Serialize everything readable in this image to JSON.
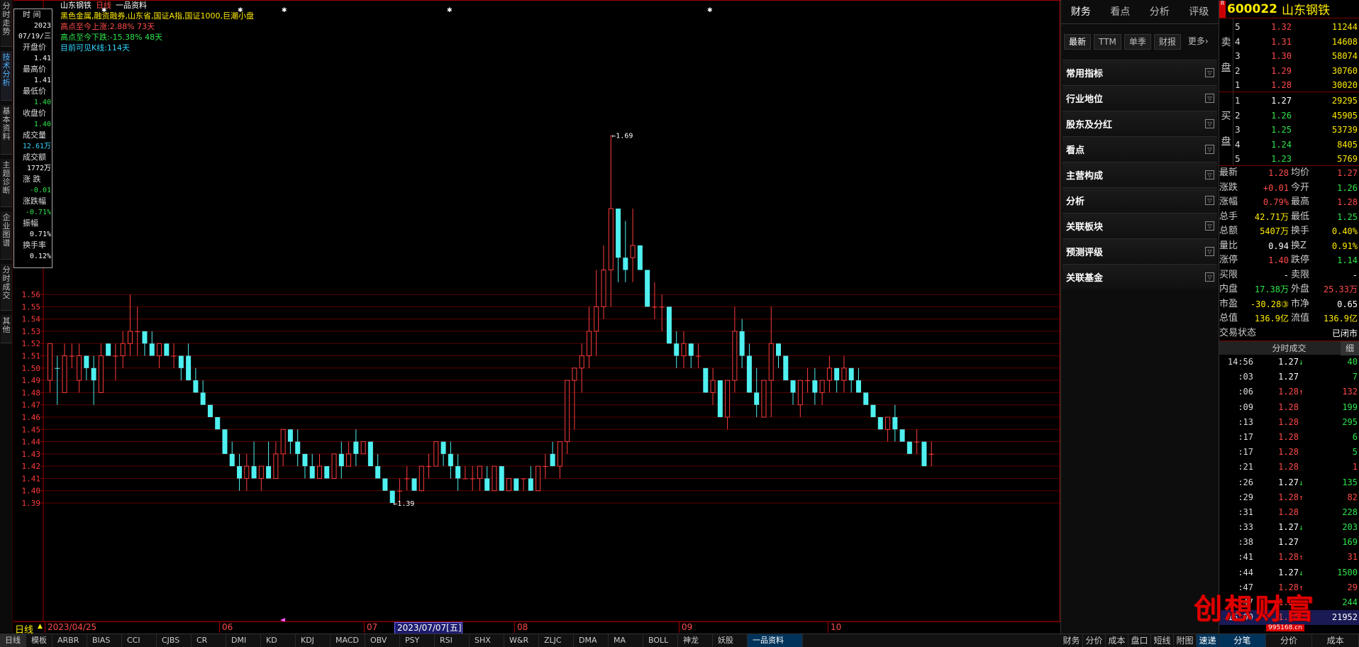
{
  "left_tabs": [
    "分时走势",
    "技术分析",
    "基本资料",
    "主题诊断",
    "企业图谱",
    "分时成交",
    "其他"
  ],
  "active_left_tab": 1,
  "chart_header": {
    "title_stock": "山东钢铁",
    "title_period": "日线",
    "title_source": "一品资料",
    "line2": "黑色金属,融资融券,山东省,国证A指,国证1000,巨潮小盘",
    "line3": "高点至今上涨:2.88% 73天",
    "line4": "高点至今下跌:-15.38% 48天",
    "line5": "目前可见K线:114天"
  },
  "data_window": {
    "rows": [
      {
        "label": "时 间",
        "value": "2023",
        "value2": "07/19/三",
        "color": "white"
      },
      {
        "label": "开盘价",
        "value": "1.41",
        "color": "white"
      },
      {
        "label": "最高价",
        "value": "1.41",
        "color": "white"
      },
      {
        "label": "最低价",
        "value": "1.40",
        "color": "green"
      },
      {
        "label": "收盘价",
        "value": "1.40",
        "color": "green"
      },
      {
        "label": "成交量",
        "value": "12.61万",
        "color": "cyan"
      },
      {
        "label": "成交额",
        "value": "1772万",
        "color": "white"
      },
      {
        "label": "涨 跌",
        "value": "-0.01",
        "color": "green"
      },
      {
        "label": "涨跌幅",
        "value": "-0.71%",
        "color": "green"
      },
      {
        "label": "振幅",
        "value": "0.71%",
        "color": "white"
      },
      {
        "label": "换手率",
        "value": "0.12%",
        "color": "white"
      }
    ]
  },
  "chart_data": {
    "type": "candlestick",
    "y_ticks": [
      "1.56",
      "1.55",
      "1.54",
      "1.53",
      "1.52",
      "1.51",
      "1.50",
      "1.49",
      "1.48",
      "1.47",
      "1.46",
      "1.45",
      "1.44",
      "1.43",
      "1.42",
      "1.41",
      "1.40",
      "1.39"
    ],
    "annotations": [
      {
        "label": "←1.69",
        "value": 1.69
      },
      {
        "label": "←1.39",
        "value": 1.39
      }
    ],
    "date_labels": [
      "2023/04/25",
      "06",
      "07",
      "2023/07/07[五]",
      "08",
      "09",
      "10"
    ],
    "period_label": "日线",
    "candles": [
      [
        1.49,
        1.52,
        1.48,
        1.52
      ],
      [
        1.5,
        1.51,
        1.47,
        1.5
      ],
      [
        1.48,
        1.52,
        1.48,
        1.51
      ],
      [
        1.51,
        1.52,
        1.5,
        1.51
      ],
      [
        1.49,
        1.52,
        1.48,
        1.51
      ],
      [
        1.51,
        1.51,
        1.49,
        1.5
      ],
      [
        1.5,
        1.51,
        1.47,
        1.49
      ],
      [
        1.48,
        1.52,
        1.48,
        1.51
      ],
      [
        1.52,
        1.52,
        1.51,
        1.51
      ],
      [
        1.51,
        1.52,
        1.49,
        1.51
      ],
      [
        1.51,
        1.53,
        1.5,
        1.52
      ],
      [
        1.52,
        1.56,
        1.51,
        1.53
      ],
      [
        1.53,
        1.55,
        1.51,
        1.53
      ],
      [
        1.53,
        1.53,
        1.51,
        1.52
      ],
      [
        1.52,
        1.53,
        1.51,
        1.51
      ],
      [
        1.51,
        1.52,
        1.5,
        1.52
      ],
      [
        1.52,
        1.52,
        1.51,
        1.51
      ],
      [
        1.51,
        1.52,
        1.5,
        1.51
      ],
      [
        1.51,
        1.51,
        1.49,
        1.5
      ],
      [
        1.51,
        1.52,
        1.49,
        1.49
      ],
      [
        1.49,
        1.5,
        1.48,
        1.48
      ],
      [
        1.48,
        1.49,
        1.47,
        1.47
      ],
      [
        1.47,
        1.47,
        1.46,
        1.46
      ],
      [
        1.46,
        1.46,
        1.45,
        1.45
      ],
      [
        1.45,
        1.45,
        1.43,
        1.43
      ],
      [
        1.43,
        1.44,
        1.42,
        1.42
      ],
      [
        1.42,
        1.43,
        1.4,
        1.41
      ],
      [
        1.41,
        1.43,
        1.4,
        1.42
      ],
      [
        1.42,
        1.44,
        1.41,
        1.41
      ],
      [
        1.41,
        1.42,
        1.4,
        1.42
      ],
      [
        1.42,
        1.44,
        1.41,
        1.41
      ],
      [
        1.41,
        1.44,
        1.41,
        1.43
      ],
      [
        1.43,
        1.45,
        1.42,
        1.45
      ],
      [
        1.45,
        1.45,
        1.43,
        1.44
      ],
      [
        1.44,
        1.45,
        1.42,
        1.43
      ],
      [
        1.43,
        1.43,
        1.41,
        1.42
      ],
      [
        1.42,
        1.43,
        1.41,
        1.41
      ],
      [
        1.41,
        1.43,
        1.41,
        1.42
      ],
      [
        1.42,
        1.42,
        1.41,
        1.41
      ],
      [
        1.41,
        1.43,
        1.41,
        1.43
      ],
      [
        1.43,
        1.44,
        1.41,
        1.42
      ],
      [
        1.42,
        1.44,
        1.42,
        1.43
      ],
      [
        1.44,
        1.45,
        1.42,
        1.43
      ],
      [
        1.43,
        1.44,
        1.43,
        1.44
      ],
      [
        1.44,
        1.44,
        1.42,
        1.42
      ],
      [
        1.42,
        1.43,
        1.41,
        1.41
      ],
      [
        1.41,
        1.41,
        1.4,
        1.4
      ],
      [
        1.4,
        1.4,
        1.39,
        1.39
      ],
      [
        1.4,
        1.41,
        1.39,
        1.4
      ],
      [
        1.41,
        1.42,
        1.4,
        1.41
      ],
      [
        1.41,
        1.41,
        1.4,
        1.4
      ],
      [
        1.4,
        1.42,
        1.4,
        1.42
      ],
      [
        1.42,
        1.43,
        1.41,
        1.42
      ],
      [
        1.42,
        1.44,
        1.42,
        1.44
      ],
      [
        1.44,
        1.44,
        1.42,
        1.43
      ],
      [
        1.43,
        1.44,
        1.41,
        1.42
      ],
      [
        1.42,
        1.43,
        1.4,
        1.41
      ],
      [
        1.41,
        1.42,
        1.41,
        1.41
      ],
      [
        1.41,
        1.42,
        1.4,
        1.41
      ],
      [
        1.41,
        1.42,
        1.4,
        1.42
      ],
      [
        1.41,
        1.42,
        1.4,
        1.4
      ],
      [
        1.4,
        1.42,
        1.4,
        1.42
      ],
      [
        1.42,
        1.42,
        1.4,
        1.4
      ],
      [
        1.4,
        1.41,
        1.4,
        1.41
      ],
      [
        1.41,
        1.41,
        1.4,
        1.4
      ],
      [
        1.41,
        1.41,
        1.4,
        1.41
      ],
      [
        1.41,
        1.42,
        1.4,
        1.4
      ],
      [
        1.4,
        1.42,
        1.4,
        1.42
      ],
      [
        1.42,
        1.43,
        1.41,
        1.42
      ],
      [
        1.43,
        1.44,
        1.42,
        1.42
      ],
      [
        1.42,
        1.44,
        1.41,
        1.44
      ],
      [
        1.44,
        1.49,
        1.43,
        1.49
      ],
      [
        1.49,
        1.5,
        1.45,
        1.5
      ],
      [
        1.5,
        1.52,
        1.48,
        1.51
      ],
      [
        1.51,
        1.55,
        1.5,
        1.53
      ],
      [
        1.53,
        1.58,
        1.51,
        1.55
      ],
      [
        1.55,
        1.6,
        1.54,
        1.58
      ],
      [
        1.58,
        1.69,
        1.55,
        1.63
      ],
      [
        1.63,
        1.63,
        1.57,
        1.59
      ],
      [
        1.59,
        1.62,
        1.57,
        1.58
      ],
      [
        1.59,
        1.63,
        1.57,
        1.6
      ],
      [
        1.6,
        1.6,
        1.58,
        1.58
      ],
      [
        1.58,
        1.58,
        1.55,
        1.55
      ],
      [
        1.55,
        1.57,
        1.54,
        1.55
      ],
      [
        1.55,
        1.56,
        1.53,
        1.55
      ],
      [
        1.55,
        1.55,
        1.52,
        1.52
      ],
      [
        1.52,
        1.53,
        1.5,
        1.51
      ],
      [
        1.51,
        1.53,
        1.5,
        1.52
      ],
      [
        1.52,
        1.52,
        1.5,
        1.51
      ],
      [
        1.51,
        1.52,
        1.5,
        1.51
      ],
      [
        1.5,
        1.5,
        1.48,
        1.48
      ],
      [
        1.48,
        1.5,
        1.47,
        1.49
      ],
      [
        1.49,
        1.49,
        1.46,
        1.46
      ],
      [
        1.46,
        1.49,
        1.45,
        1.49
      ],
      [
        1.49,
        1.55,
        1.48,
        1.53
      ],
      [
        1.53,
        1.54,
        1.5,
        1.51
      ],
      [
        1.51,
        1.52,
        1.48,
        1.48
      ],
      [
        1.48,
        1.5,
        1.46,
        1.47
      ],
      [
        1.46,
        1.49,
        1.46,
        1.49
      ],
      [
        1.49,
        1.55,
        1.46,
        1.52
      ],
      [
        1.52,
        1.52,
        1.5,
        1.51
      ],
      [
        1.51,
        1.51,
        1.49,
        1.49
      ],
      [
        1.49,
        1.49,
        1.47,
        1.48
      ],
      [
        1.47,
        1.49,
        1.46,
        1.49
      ],
      [
        1.49,
        1.5,
        1.48,
        1.49
      ],
      [
        1.49,
        1.5,
        1.47,
        1.48
      ],
      [
        1.48,
        1.49,
        1.47,
        1.49
      ],
      [
        1.49,
        1.51,
        1.48,
        1.5
      ],
      [
        1.5,
        1.5,
        1.48,
        1.49
      ],
      [
        1.49,
        1.51,
        1.48,
        1.5
      ],
      [
        1.5,
        1.5,
        1.48,
        1.49
      ],
      [
        1.49,
        1.5,
        1.48,
        1.48
      ],
      [
        1.48,
        1.48,
        1.47,
        1.47
      ],
      [
        1.47,
        1.47,
        1.46,
        1.46
      ],
      [
        1.46,
        1.46,
        1.45,
        1.45
      ],
      [
        1.45,
        1.46,
        1.44,
        1.46
      ],
      [
        1.46,
        1.47,
        1.44,
        1.45
      ],
      [
        1.45,
        1.45,
        1.44,
        1.44
      ],
      [
        1.44,
        1.44,
        1.43,
        1.43
      ],
      [
        1.44,
        1.45,
        1.43,
        1.44
      ],
      [
        1.44,
        1.44,
        1.42,
        1.42
      ],
      [
        1.43,
        1.44,
        1.42,
        1.43
      ]
    ]
  },
  "indicator_tabs": [
    "日线",
    "模板",
    "ARBR",
    "BIAS",
    "CCI",
    "CJBS",
    "CR",
    "DMI",
    "KD",
    "KDJ",
    "MACD",
    "OBV",
    "PSY",
    "RSI",
    "SHX",
    "W&R",
    "ZLJC",
    "DMA",
    "MA",
    "BOLL",
    "神龙",
    "妖股",
    "一品资料"
  ],
  "active_indicator": "一品资料",
  "mid_tabs": [
    "财务",
    "看点",
    "分析",
    "评级"
  ],
  "mid_subtabs": [
    "最新",
    "TTM",
    "单季",
    "财报",
    "更多›"
  ],
  "mid_sections": [
    "常用指标",
    "行业地位",
    "股东及分红",
    "看点",
    "主营构成",
    "分析",
    "关联板块",
    "预测评级",
    "关联基金"
  ],
  "mid_bottom": [
    "财务",
    "分价",
    "成本",
    "盘口",
    "短线",
    "附图",
    "速递"
  ],
  "quote_header": {
    "code": "600022",
    "name": "山东钢铁",
    "badge": "R"
  },
  "sell_label": [
    "卖",
    "盘"
  ],
  "buy_label": [
    "买",
    "盘"
  ],
  "sells": [
    {
      "lv": "5",
      "price": "1.32",
      "vol": "11244"
    },
    {
      "lv": "4",
      "price": "1.31",
      "vol": "14608"
    },
    {
      "lv": "3",
      "price": "1.30",
      "vol": "58074"
    },
    {
      "lv": "2",
      "price": "1.29",
      "vol": "30760"
    },
    {
      "lv": "1",
      "price": "1.28",
      "vol": "30020"
    }
  ],
  "buys": [
    {
      "lv": "1",
      "price": "1.27",
      "vol": "29295"
    },
    {
      "lv": "2",
      "price": "1.26",
      "vol": "45905"
    },
    {
      "lv": "3",
      "price": "1.25",
      "vol": "53739"
    },
    {
      "lv": "4",
      "price": "1.24",
      "vol": "8405"
    },
    {
      "lv": "5",
      "price": "1.23",
      "vol": "5769"
    }
  ],
  "quote_rows": [
    {
      "k": "最新",
      "v": "1.28",
      "vc": "red",
      "k2": "均价",
      "v2": "1.27",
      "v2c": "red"
    },
    {
      "k": "涨跌",
      "v": "+0.01",
      "vc": "red",
      "k2": "今开",
      "v2": "1.26",
      "v2c": "green"
    },
    {
      "k": "涨幅",
      "v": "0.79%",
      "vc": "red",
      "k2": "最高",
      "v2": "1.28",
      "v2c": "red"
    },
    {
      "k": "总手",
      "v": "42.71万",
      "vc": "yellow",
      "k2": "最低",
      "v2": "1.25",
      "v2c": "green"
    },
    {
      "k": "总额",
      "v": "5407万",
      "vc": "yellow",
      "k2": "换手",
      "v2": "0.40%",
      "v2c": "yellow"
    },
    {
      "k": "量比",
      "v": "0.94",
      "vc": "white",
      "k2": "换Z",
      "v2": "0.91%",
      "v2c": "yellow"
    },
    {
      "k": "涨停",
      "v": "1.40",
      "vc": "red",
      "k2": "跌停",
      "v2": "1.14",
      "v2c": "green"
    },
    {
      "k": "买限",
      "v": "-",
      "vc": "white",
      "k2": "卖限",
      "v2": "-",
      "v2c": "white"
    },
    {
      "k": "内盘",
      "v": "17.38万",
      "vc": "green",
      "k2": "外盘",
      "v2": "25.33万",
      "v2c": "red"
    },
    {
      "k": "市盈",
      "v": "-30.28③",
      "vc": "yellow",
      "k2": "市净",
      "v2": "0.65",
      "v2c": "white"
    },
    {
      "k": "总值",
      "v": "136.9亿",
      "vc": "yellow",
      "k2": "流值",
      "v2": "136.9亿",
      "v2c": "yellow"
    },
    {
      "k": "交易状态",
      "v": "",
      "vc": "white",
      "k2": "",
      "v2": "已闭市",
      "v2c": "white"
    }
  ],
  "ticks_title": "分时成交",
  "ticks_detail": "细",
  "ticks": [
    {
      "t": "14:56",
      "p": "1.27",
      "pc": "white",
      "a": "↓",
      "ac": "green",
      "v": "40",
      "vc": "green"
    },
    {
      "t": ":03",
      "p": "1.27",
      "pc": "white",
      "a": "",
      "ac": "",
      "v": "7",
      "vc": "green"
    },
    {
      "t": ":06",
      "p": "1.28",
      "pc": "red",
      "a": "↑",
      "ac": "red",
      "v": "132",
      "vc": "red"
    },
    {
      "t": ":09",
      "p": "1.28",
      "pc": "red",
      "a": "",
      "ac": "",
      "v": "199",
      "vc": "green"
    },
    {
      "t": ":13",
      "p": "1.28",
      "pc": "red",
      "a": "",
      "ac": "",
      "v": "295",
      "vc": "green"
    },
    {
      "t": ":17",
      "p": "1.28",
      "pc": "red",
      "a": "",
      "ac": "",
      "v": "6",
      "vc": "green"
    },
    {
      "t": ":17",
      "p": "1.28",
      "pc": "red",
      "a": "",
      "ac": "",
      "v": "5",
      "vc": "green"
    },
    {
      "t": ":21",
      "p": "1.28",
      "pc": "red",
      "a": "",
      "ac": "",
      "v": "1",
      "vc": "red"
    },
    {
      "t": ":26",
      "p": "1.27",
      "pc": "white",
      "a": "↓",
      "ac": "green",
      "v": "135",
      "vc": "green"
    },
    {
      "t": ":29",
      "p": "1.28",
      "pc": "red",
      "a": "↑",
      "ac": "red",
      "v": "82",
      "vc": "red"
    },
    {
      "t": ":31",
      "p": "1.28",
      "pc": "red",
      "a": "",
      "ac": "",
      "v": "228",
      "vc": "green"
    },
    {
      "t": ":33",
      "p": "1.27",
      "pc": "white",
      "a": "↓",
      "ac": "green",
      "v": "203",
      "vc": "green"
    },
    {
      "t": ":38",
      "p": "1.27",
      "pc": "white",
      "a": "",
      "ac": "",
      "v": "169",
      "vc": "green"
    },
    {
      "t": ":41",
      "p": "1.28",
      "pc": "red",
      "a": "↑",
      "ac": "red",
      "v": "31",
      "vc": "red"
    },
    {
      "t": ":44",
      "p": "1.27",
      "pc": "white",
      "a": "↓",
      "ac": "green",
      "v": "1500",
      "vc": "green"
    },
    {
      "t": ":47",
      "p": "1.28",
      "pc": "red",
      "a": "↑",
      "ac": "red",
      "v": "29",
      "vc": "red"
    },
    {
      "t": ":47",
      "p": "1.28",
      "pc": "red",
      "a": "",
      "ac": "",
      "v": "244",
      "vc": "green"
    },
    {
      "t": "15:00",
      "p": "1.28",
      "pc": "red",
      "a": "",
      "ac": "",
      "v": "21952",
      "vc": "white"
    }
  ],
  "right_bottom": [
    "分笔",
    "分价",
    "成本"
  ],
  "watermark": "创想财富",
  "watermark_url": "995168.cn",
  "colors": {
    "up": "#ff3b3b",
    "down": "#4ff0f0",
    "grid": "#5a0000",
    "axis": "#a00000"
  }
}
